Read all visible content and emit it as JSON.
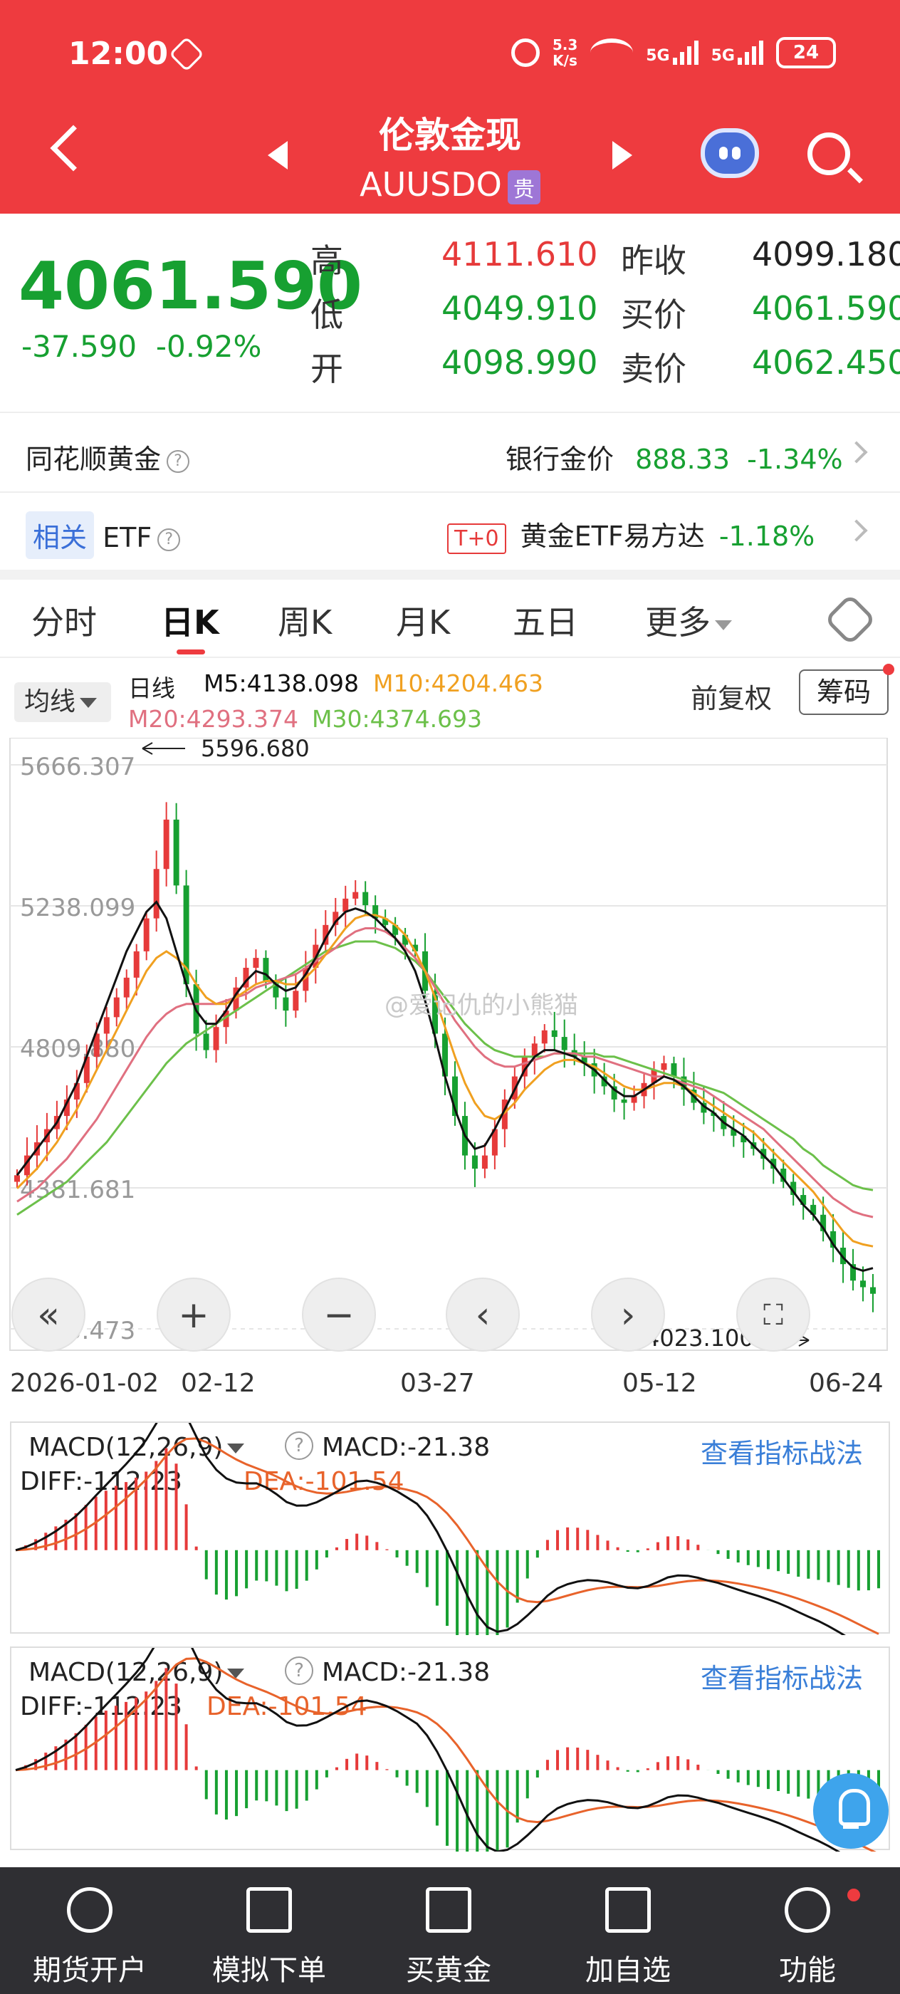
{
  "status_bar": {
    "time": "12:00",
    "speed_top": "5.3",
    "speed_bottom": "K/s",
    "net1": "5G",
    "net2": "5G",
    "battery": "24"
  },
  "header": {
    "title": "伦敦金现",
    "code": "AUUSDO",
    "badge": "贵"
  },
  "quote": {
    "price": "4061.590",
    "change": "-37.590",
    "change_pct": "-0.92%",
    "high_label": "高",
    "high": "4111.610",
    "low_label": "低",
    "low": "4049.910",
    "open_label": "开",
    "open": "4098.990",
    "prev_close_label": "昨收",
    "prev_close": "4099.180",
    "bid_label": "买价",
    "bid": "4061.590",
    "ask_label": "卖价",
    "ask": "4062.450"
  },
  "row1": {
    "label": "同花顺黄金",
    "right_label": "银行金价",
    "value": "888.33",
    "pct": "-1.34%"
  },
  "row2": {
    "tag": "相关",
    "label": "ETF",
    "badge": "T+0",
    "fund": "黄金ETF易方达",
    "pct": "-1.18%"
  },
  "tabs": [
    "分时",
    "日K",
    "周K",
    "月K",
    "五日",
    "更多"
  ],
  "chart_header": {
    "ma_button": "均线",
    "line_type": "日线",
    "m5": "M5:4138.098",
    "m10": "M10:4204.463",
    "m20": "M20:4293.374",
    "m30": "M30:4374.693",
    "adjust": "前复权",
    "chip": "筹码"
  },
  "chart_data": {
    "type": "candlestick",
    "y_ticks": [
      "5666.307",
      "5238.099",
      "4809.880",
      "4381.681",
      "3953.473"
    ],
    "x_ticks": [
      "2026-01-02",
      "02-12",
      "03-27",
      "05-12",
      "06-24"
    ],
    "max_label": "5596.680",
    "min_label": "4023.100",
    "close_series": [
      4420,
      4480,
      4520,
      4560,
      4600,
      4650,
      4700,
      4780,
      4850,
      4900,
      4960,
      5020,
      5100,
      5200,
      5350,
      5500,
      5300,
      5000,
      4850,
      4800,
      4870,
      4920,
      4990,
      5050,
      5080,
      5010,
      4960,
      4920,
      4980,
      5050,
      5120,
      5180,
      5220,
      5260,
      5280,
      5240,
      5200,
      5180,
      5150,
      5120,
      5100,
      4980,
      4850,
      4720,
      4600,
      4480,
      4440,
      4480,
      4560,
      4650,
      4720,
      4780,
      4820,
      4860,
      4840,
      4800,
      4780,
      4760,
      4720,
      4690,
      4650,
      4640,
      4660,
      4700,
      4740,
      4760,
      4720,
      4680,
      4640,
      4610,
      4600,
      4560,
      4540,
      4520,
      4500,
      4470,
      4440,
      4400,
      4360,
      4330,
      4300,
      4250,
      4200,
      4150,
      4100,
      4080,
      4060
    ],
    "ma5": [
      4420,
      4460,
      4500,
      4540,
      4580,
      4640,
      4700,
      4780,
      4860,
      4940,
      5020,
      5100,
      5160,
      5220,
      5250,
      5200,
      5100,
      5000,
      4920,
      4880,
      4880,
      4920,
      4970,
      5010,
      5040,
      5030,
      5000,
      4980,
      4990,
      5030,
      5080,
      5140,
      5190,
      5220,
      5230,
      5220,
      5200,
      5170,
      5140,
      5100,
      5040,
      4950,
      4840,
      4720,
      4620,
      4540,
      4500,
      4510,
      4560,
      4620,
      4680,
      4740,
      4780,
      4800,
      4800,
      4790,
      4780,
      4760,
      4740,
      4710,
      4680,
      4660,
      4660,
      4680,
      4700,
      4720,
      4710,
      4690,
      4660,
      4630,
      4610,
      4580,
      4560,
      4540,
      4510,
      4480,
      4450,
      4410,
      4370,
      4330,
      4300,
      4260,
      4210,
      4170,
      4140,
      4130,
      4138
    ],
    "ma10": [
      4380,
      4410,
      4440,
      4480,
      4520,
      4570,
      4620,
      4680,
      4740,
      4800,
      4860,
      4920,
      4980,
      5040,
      5080,
      5100,
      5080,
      5050,
      5000,
      4960,
      4940,
      4940,
      4960,
      4980,
      5000,
      5010,
      5010,
      5000,
      5000,
      5020,
      5050,
      5090,
      5130,
      5170,
      5200,
      5210,
      5210,
      5200,
      5180,
      5150,
      5100,
      5040,
      4960,
      4870,
      4780,
      4700,
      4640,
      4600,
      4590,
      4610,
      4640,
      4680,
      4710,
      4740,
      4760,
      4770,
      4770,
      4760,
      4750,
      4730,
      4710,
      4690,
      4680,
      4680,
      4690,
      4700,
      4700,
      4690,
      4670,
      4650,
      4630,
      4610,
      4590,
      4570,
      4550,
      4520,
      4490,
      4460,
      4430,
      4400,
      4370,
      4330,
      4290,
      4250,
      4220,
      4210,
      4204
    ],
    "ma20": [
      4340,
      4360,
      4380,
      4410,
      4440,
      4470,
      4510,
      4550,
      4590,
      4640,
      4690,
      4740,
      4790,
      4840,
      4880,
      4910,
      4930,
      4940,
      4940,
      4940,
      4940,
      4950,
      4960,
      4970,
      4990,
      5000,
      5010,
      5020,
      5030,
      5050,
      5070,
      5090,
      5110,
      5140,
      5160,
      5170,
      5170,
      5160,
      5140,
      5110,
      5080,
      5040,
      4990,
      4940,
      4890,
      4850,
      4810,
      4780,
      4760,
      4750,
      4750,
      4760,
      4770,
      4780,
      4790,
      4790,
      4790,
      4780,
      4780,
      4770,
      4760,
      4750,
      4740,
      4730,
      4720,
      4720,
      4710,
      4700,
      4690,
      4680,
      4660,
      4640,
      4620,
      4600,
      4580,
      4560,
      4530,
      4500,
      4470,
      4440,
      4410,
      4380,
      4350,
      4330,
      4310,
      4300,
      4293
    ],
    "ma30": [
      4300,
      4320,
      4340,
      4360,
      4380,
      4400,
      4430,
      4460,
      4490,
      4520,
      4560,
      4600,
      4640,
      4680,
      4720,
      4760,
      4790,
      4820,
      4840,
      4860,
      4880,
      4900,
      4920,
      4940,
      4960,
      4980,
      5000,
      5020,
      5040,
      5060,
      5080,
      5100,
      5110,
      5120,
      5130,
      5130,
      5130,
      5120,
      5110,
      5090,
      5070,
      5040,
      5000,
      4960,
      4920,
      4880,
      4850,
      4820,
      4800,
      4790,
      4780,
      4780,
      4780,
      4780,
      4790,
      4790,
      4790,
      4790,
      4790,
      4780,
      4780,
      4770,
      4760,
      4750,
      4740,
      4730,
      4720,
      4710,
      4700,
      4690,
      4680,
      4670,
      4650,
      4630,
      4610,
      4590,
      4570,
      4550,
      4530,
      4500,
      4480,
      4450,
      4430,
      4410,
      4390,
      4380,
      4375
    ]
  },
  "chart_controls": {
    "zoom_out": "−",
    "zoom_in": "+",
    "prev": "‹",
    "next": "›",
    "first": "«",
    "fullscreen": "⛶"
  },
  "watermark": "@爱记仇的小熊猫",
  "macd1": {
    "title": "MACD(12,26,9)",
    "macd": "MACD:-21.38",
    "diff": "DIFF:-112.23",
    "dea": "DEA:-101.54",
    "link": "查看指标战法"
  },
  "macd2": {
    "title": "MACD(12,26,9)",
    "macd": "MACD:-21.38",
    "diff": "DIFF:-112.23",
    "dea": "DEA:-101.54",
    "link": "查看指标战法"
  },
  "bottom_nav": [
    "期货开户",
    "模拟下单",
    "买黄金",
    "加自选",
    "功能"
  ],
  "colors": {
    "red": "#ee3b3f",
    "up": "#e63a3a",
    "down": "#17a031",
    "ma5": "#111111",
    "ma10": "#f0a020",
    "ma20": "#e07080",
    "ma30": "#6cc04a"
  }
}
